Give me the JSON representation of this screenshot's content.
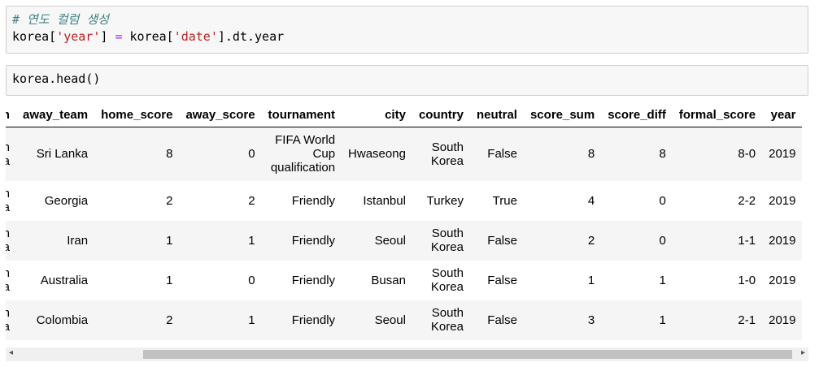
{
  "cells": {
    "cell1": {
      "comment": "# 연도 컬럼 생성",
      "line2": {
        "a": "korea[",
        "b": "'year'",
        "c": "] ",
        "d": "=",
        "e": " korea[",
        "f": "'date'",
        "g": "].dt.year"
      }
    },
    "cell2": {
      "code": "korea.head()"
    }
  },
  "table": {
    "columns": [
      "eam",
      "away_team",
      "home_score",
      "away_score",
      "tournament",
      "city",
      "country",
      "neutral",
      "score_sum",
      "score_diff",
      "formal_score",
      "year"
    ],
    "rows": [
      [
        "outh\norea",
        "Sri Lanka",
        "8",
        "0",
        "FIFA World Cup qualification",
        "Hwaseong",
        "South Korea",
        "False",
        "8",
        "8",
        "8-0",
        "2019"
      ],
      [
        "outh\norea",
        "Georgia",
        "2",
        "2",
        "Friendly",
        "Istanbul",
        "Turkey",
        "True",
        "4",
        "0",
        "2-2",
        "2019"
      ],
      [
        "outh\norea",
        "Iran",
        "1",
        "1",
        "Friendly",
        "Seoul",
        "South Korea",
        "False",
        "2",
        "0",
        "1-1",
        "2019"
      ],
      [
        "outh\norea",
        "Australia",
        "1",
        "0",
        "Friendly",
        "Busan",
        "South Korea",
        "False",
        "1",
        "1",
        "1-0",
        "2019"
      ],
      [
        "outh\norea",
        "Colombia",
        "2",
        "1",
        "Friendly",
        "Seoul",
        "South Korea",
        "False",
        "3",
        "1",
        "2-1",
        "2019"
      ]
    ]
  },
  "scrollbar": {
    "left_arrow": "◂",
    "right_arrow": "▸"
  }
}
